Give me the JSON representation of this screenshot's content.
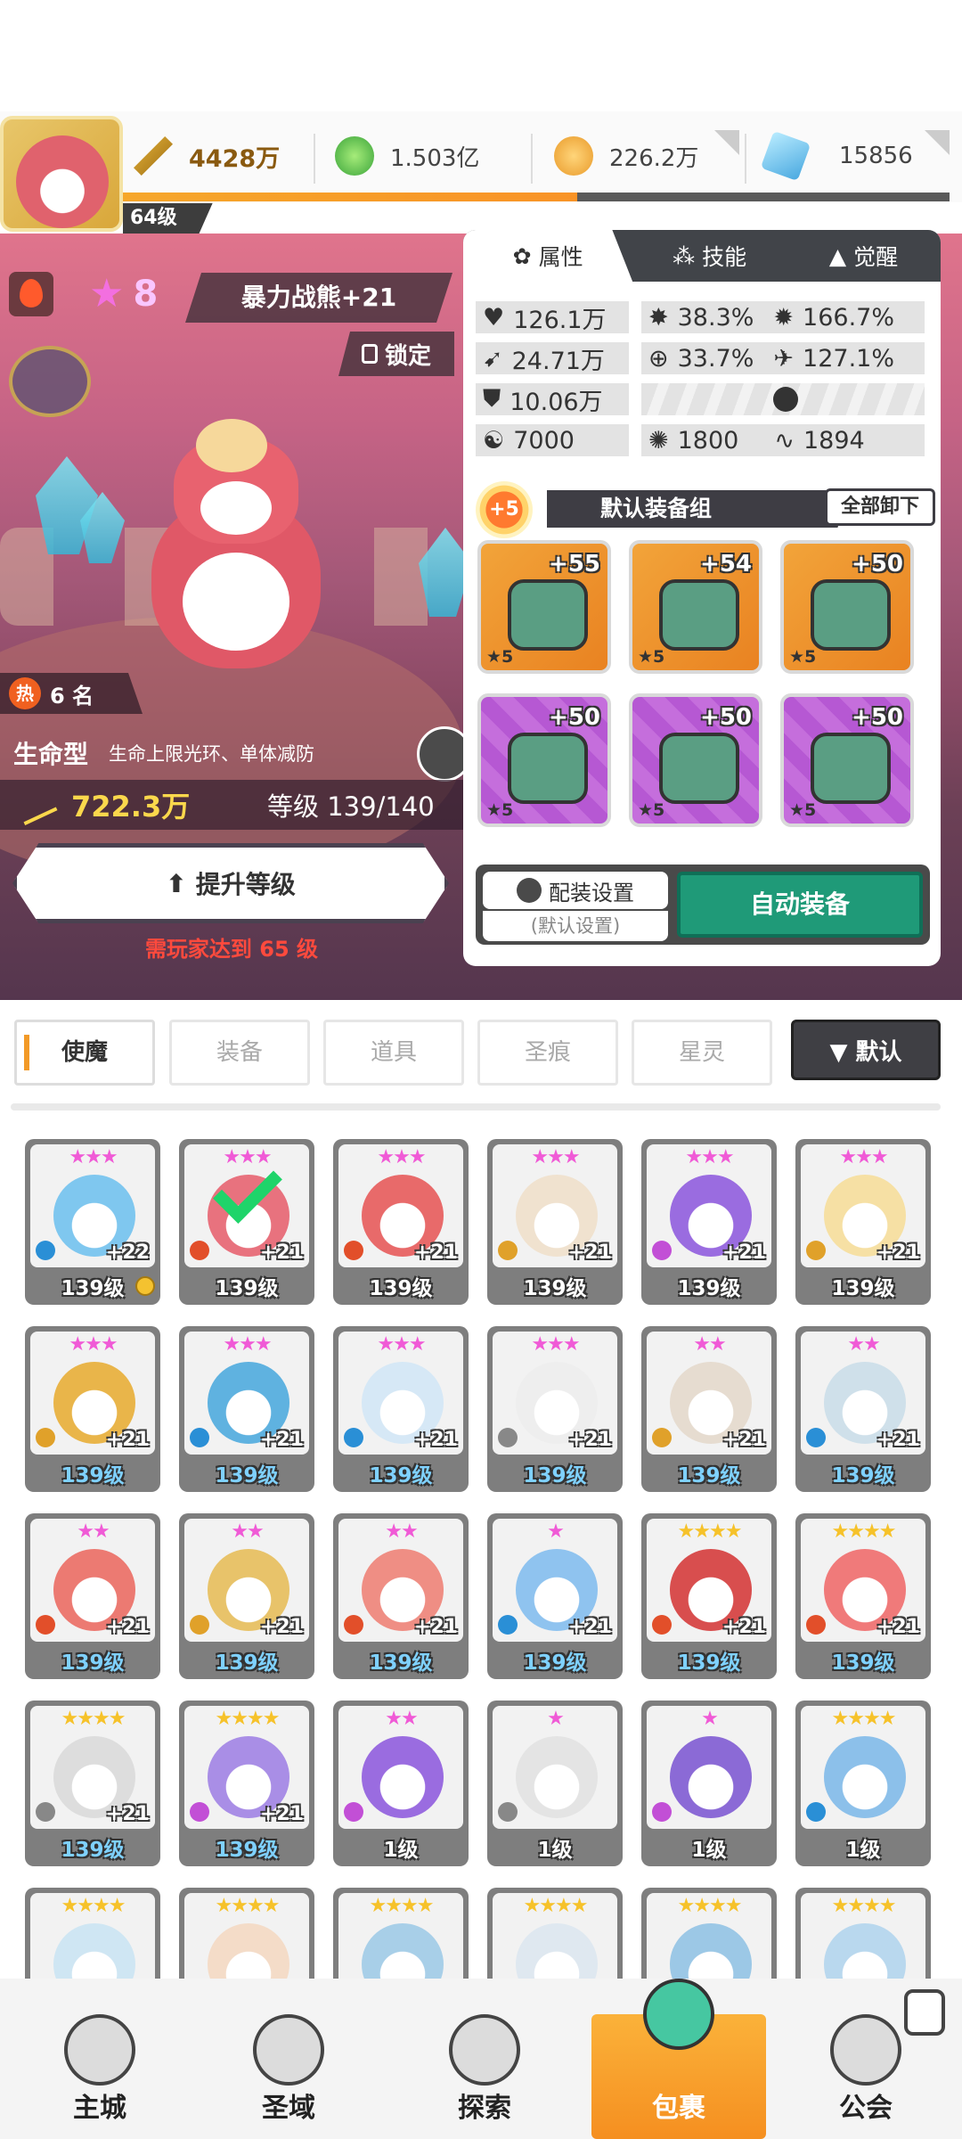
{
  "topbar": {
    "power": "4428万",
    "gems": "1.503亿",
    "coins": "226.2万",
    "crystals": "15856",
    "player_level": "64级",
    "exp_progress": 0.55
  },
  "hero": {
    "star_count": "8",
    "name": "暴力战熊+21",
    "lock_label": "锁定",
    "hot_label": "热",
    "rank": "6 名",
    "type": "生命型",
    "type_desc": "生命上限光环、单体减防",
    "power": "722.3万",
    "level": "等级 139/140",
    "levelup_label": "提升等级",
    "levelup_note": "需玩家达到 65 级"
  },
  "panel": {
    "tabs": [
      {
        "label": "属性",
        "icon": "attribute-icon"
      },
      {
        "label": "技能",
        "icon": "skill-icon"
      },
      {
        "label": "觉醒",
        "icon": "awaken-icon"
      }
    ],
    "stats": {
      "hp": "126.1万",
      "crit_rate": "38.3%",
      "crit_dmg": "166.7%",
      "atk": "24.71万",
      "hit": "33.7%",
      "speed_pct": "127.1%",
      "def": "10.06万",
      "stat_a": "7000",
      "stat_b": "1800",
      "stat_c": "1894"
    },
    "set_plus": "+5",
    "set_name": "默认装备组",
    "unequip_label": "全部卸下",
    "equipment": [
      {
        "plus": "+55",
        "stars": "★5",
        "rarity": "orange",
        "item": "sword"
      },
      {
        "plus": "+54",
        "stars": "★5",
        "rarity": "orange",
        "item": "helmet"
      },
      {
        "plus": "+50",
        "stars": "★5",
        "rarity": "orange",
        "item": "armor"
      },
      {
        "plus": "+50",
        "stars": "★5",
        "rarity": "purple",
        "item": "belt"
      },
      {
        "plus": "+50",
        "stars": "★5",
        "rarity": "purple",
        "item": "necklace"
      },
      {
        "plus": "+50",
        "stars": "★5",
        "rarity": "purple",
        "item": "boots"
      }
    ],
    "config_label": "配装设置",
    "config_sub": "(默认设置)",
    "auto_label": "自动装备"
  },
  "filter": {
    "tabs": [
      "使魔",
      "装备",
      "道具",
      "圣痕",
      "星灵"
    ],
    "sort_label": "▼ 默认"
  },
  "grid": [
    {
      "stars": "★★★",
      "plus": "+22",
      "level": "139级",
      "color": "#7fc7ef",
      "elem": "#2a8fd6",
      "blue": false,
      "badge": true
    },
    {
      "stars": "★★★",
      "plus": "+21",
      "level": "139级",
      "color": "#e8727e",
      "elem": "#e24f2a",
      "blue": false,
      "check": true
    },
    {
      "stars": "★★★",
      "plus": "+21",
      "level": "139级",
      "color": "#e86a6a",
      "elem": "#e24f2a",
      "blue": false
    },
    {
      "stars": "★★★",
      "plus": "+21",
      "level": "139级",
      "color": "#f0e2cf",
      "elem": "#e0a12a",
      "blue": false
    },
    {
      "stars": "★★★",
      "plus": "+21",
      "level": "139级",
      "color": "#9a6ce0",
      "elem": "#c24fd6",
      "blue": false
    },
    {
      "stars": "★★★",
      "plus": "+21",
      "level": "139级",
      "color": "#f6e0a4",
      "elem": "#e0a12a",
      "blue": false
    },
    {
      "stars": "★★★",
      "plus": "+21",
      "level": "139级",
      "color": "#e9b54a",
      "elem": "#e0a12a",
      "blue": true
    },
    {
      "stars": "★★★",
      "plus": "+21",
      "level": "139级",
      "color": "#5fb2e0",
      "elem": "#2a8fd6",
      "blue": true
    },
    {
      "stars": "★★★",
      "plus": "+21",
      "level": "139级",
      "color": "#d6e8f6",
      "elem": "#2a8fd6",
      "blue": true
    },
    {
      "stars": "★★★",
      "plus": "+21",
      "level": "139级",
      "color": "#eeeeee",
      "elem": "#888888",
      "blue": true
    },
    {
      "stars": "★★",
      "plus": "+21",
      "level": "139级",
      "color": "#e6dcd0",
      "elem": "#e0a12a",
      "blue": true
    },
    {
      "stars": "★★",
      "plus": "+21",
      "level": "139级",
      "color": "#cfe0ea",
      "elem": "#2a8fd6",
      "blue": true
    },
    {
      "stars": "★★",
      "plus": "+21",
      "level": "139级",
      "color": "#ec7a72",
      "elem": "#e24f2a",
      "blue": true
    },
    {
      "stars": "★★",
      "plus": "+21",
      "level": "139级",
      "color": "#e8c36a",
      "elem": "#e0a12a",
      "blue": true
    },
    {
      "stars": "★★",
      "plus": "+21",
      "level": "139级",
      "color": "#ef8e84",
      "elem": "#e24f2a",
      "blue": true
    },
    {
      "stars": "★",
      "plus": "+21",
      "level": "139级",
      "color": "#8fc3ef",
      "elem": "#2a8fd6",
      "blue": true
    },
    {
      "stars": "★★★★",
      "plus": "+21",
      "level": "139级",
      "color": "#d84e4e",
      "elem": "#e24f2a",
      "blue": true
    },
    {
      "stars": "★★★★",
      "plus": "+21",
      "level": "139级",
      "color": "#f07a7a",
      "elem": "#e24f2a",
      "blue": true
    },
    {
      "stars": "★★★★",
      "plus": "+21",
      "level": "139级",
      "color": "#dddddd",
      "elem": "#888888",
      "blue": true
    },
    {
      "stars": "★★★★",
      "plus": "+21",
      "level": "139级",
      "color": "#a98ee6",
      "elem": "#c24fd6",
      "blue": true
    },
    {
      "stars": "★★",
      "plus": "",
      "level": "1级",
      "color": "#9a6ce0",
      "elem": "#c24fd6",
      "blue": false
    },
    {
      "stars": "★",
      "plus": "",
      "level": "1级",
      "color": "#e4e4e4",
      "elem": "#888888",
      "blue": false
    },
    {
      "stars": "★",
      "plus": "",
      "level": "1级",
      "color": "#8b6ad6",
      "elem": "#c24fd6",
      "blue": false
    },
    {
      "stars": "★★★★",
      "plus": "",
      "level": "1级",
      "color": "#8cc0ea",
      "elem": "#2a8fd6",
      "blue": false
    },
    {
      "stars": "★★★★",
      "plus": "",
      "level": "",
      "color": "#cfe6f3",
      "elem": "#2a8fd6",
      "blue": false
    },
    {
      "stars": "★★★★",
      "plus": "",
      "level": "",
      "color": "#f4dcc8",
      "elem": "#e0a12a",
      "blue": false
    },
    {
      "stars": "★★★★",
      "plus": "",
      "level": "",
      "color": "#a8cfe8",
      "elem": "#2a8fd6",
      "blue": false
    },
    {
      "stars": "★★★★",
      "plus": "",
      "level": "",
      "color": "#dfe8f0",
      "elem": "#2a8fd6",
      "blue": false
    },
    {
      "stars": "★★★★",
      "plus": "",
      "level": "",
      "color": "#9cc8e6",
      "elem": "#2a8fd6",
      "blue": false
    },
    {
      "stars": "★★★★",
      "plus": "",
      "level": "",
      "color": "#b9d8ee",
      "elem": "#2a8fd6",
      "blue": false
    }
  ],
  "nav": [
    {
      "label": "主城",
      "icon": "castle-icon"
    },
    {
      "label": "圣域",
      "icon": "vortex-icon"
    },
    {
      "label": "探索",
      "icon": "sword-icon"
    },
    {
      "label": "包裹",
      "icon": "bag-icon"
    },
    {
      "label": "公会",
      "icon": "guild-icon"
    }
  ],
  "colors": {
    "accent": "#f29a28",
    "auto_button": "#1f9a78",
    "panel_dark": "#414449"
  }
}
